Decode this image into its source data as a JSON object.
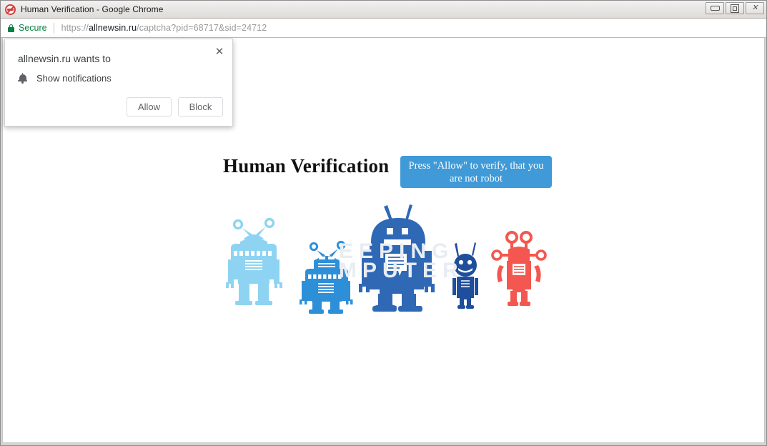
{
  "window": {
    "title": "Human Verification - Google Chrome",
    "favicon": "no-robot-icon",
    "controls": {
      "minimize": "–",
      "maximize": "□",
      "close": "✕"
    }
  },
  "omnibox": {
    "security_icon": "lock-icon",
    "security_label": "Secure",
    "url_scheme": "https://",
    "url_host": "allnewsin.ru",
    "url_path": "/captcha?pid=68717&sid=24712",
    "url_full": "https://allnewsin.ru/captcha?pid=68717&sid=24712"
  },
  "permission_bubble": {
    "title": "allnewsin.ru wants to",
    "close_icon": "✕",
    "permission_icon": "bell-icon",
    "permission_label": "Show notifications",
    "allow_label": "Allow",
    "block_label": "Block"
  },
  "page": {
    "heading": "Human Verification",
    "cta_label": "Press \"Allow\" to verify, that you are not robot",
    "cta_color": "#3f9ad7",
    "watermark": "EEPING\nMPUTER",
    "illustration": {
      "name": "five-robots-illustration",
      "robots": [
        {
          "name": "robot-light-blue",
          "color": "#8ed4f2"
        },
        {
          "name": "robot-medium-blue",
          "color": "#2e8fd9"
        },
        {
          "name": "robot-dark-blue",
          "color": "#2f68b5"
        },
        {
          "name": "robot-navy-small",
          "color": "#1f4f9c"
        },
        {
          "name": "robot-red",
          "color": "#f4574f"
        }
      ]
    }
  }
}
